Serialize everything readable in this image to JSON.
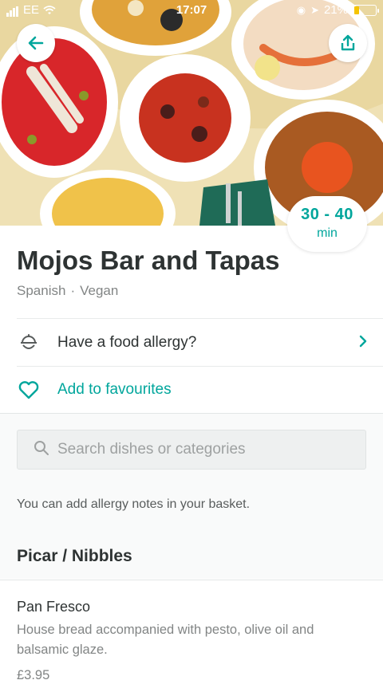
{
  "status_bar": {
    "carrier": "EE",
    "time": "17:07",
    "battery": "21%",
    "battery_level": 0.21
  },
  "restaurant": {
    "name": "Mojos Bar and Tapas",
    "cuisines": [
      "Spanish",
      "·",
      "Vegan"
    ],
    "eta_range": "30 - 40",
    "eta_unit": "min"
  },
  "actions": {
    "allergy_label": "Have a food allergy?",
    "favourites_label": "Add to favourites"
  },
  "search": {
    "placeholder": "Search dishes or categories"
  },
  "allergy_note": "You can add allergy notes in your basket.",
  "menu": {
    "section_title": "Picar / Nibbles",
    "items": [
      {
        "name": "Pan Fresco",
        "description": "House bread accompanied with pesto, olive oil and balsamic glaze.",
        "price": "£3.95"
      }
    ]
  },
  "colors": {
    "accent": "#00a69c",
    "text": "#2e3333",
    "muted": "#828585"
  },
  "icons": [
    "back-arrow-icon",
    "share-icon",
    "allergy-icon",
    "chevron-right-icon",
    "heart-icon",
    "search-icon"
  ]
}
